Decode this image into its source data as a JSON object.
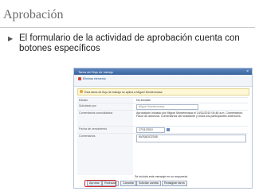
{
  "slide": {
    "title": "Aprobación",
    "bullet": "El formulario de la actividad de aprobación cuenta con botones específicos"
  },
  "screenshot": {
    "window_title": "Tarea del flujo de trabajo",
    "toolbar_label": "Eliminar elemento",
    "notice": "Esta tarea de flujo de trabajo se aplica a Miguel Montenrossa",
    "fields": [
      {
        "label": "Estado",
        "value": "No iniciado"
      },
      {
        "label": "Solicitado por",
        "value": "Miguel Montenrossa"
      },
      {
        "label": "Comentarios consolidados",
        "value": "Aprobación iniciado por Miguel Montenrossa el 14/11/2010 04:46 a.m. Comentarios: Favor de autorizar. Comentarios del solicitante y todos los participantes anteriores."
      },
      {
        "label": "Fecha de vencimiento",
        "value": "17/11/2010"
      },
      {
        "label": "Comentarios",
        "value": "AVISADO2345"
      }
    ],
    "reply_note": "Se incluirá este mensaje en su respuesta.",
    "buttons": [
      "Aprobar",
      "Rechazar",
      "Cancelar",
      "Solicitar cambio",
      "Reasignar tarea"
    ]
  }
}
